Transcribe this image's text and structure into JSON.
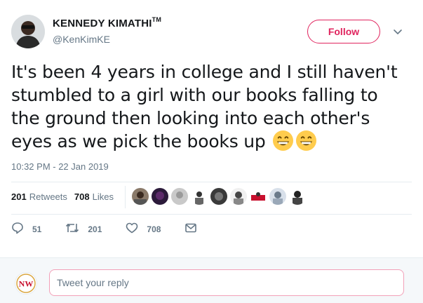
{
  "user": {
    "name": "KENNEDY KIMATHI",
    "trademark": "TM",
    "handle": "@KenKimKE"
  },
  "follow_label": "Follow",
  "tweet": {
    "text": "It's been 4 years in college and I still haven't stumbled to a girl with our books falling to the ground then looking into each other's eyes as we pick the books up",
    "emoji_names": [
      "grinning-face-icon",
      "grinning-face-icon"
    ],
    "timestamp": "10:32 PM - 22 Jan 2019"
  },
  "stats": {
    "retweets_count": "201",
    "retweets_label": "Retweets",
    "likes_count": "708",
    "likes_label": "Likes",
    "liker_avatar_count": 10
  },
  "actions": {
    "reply_count": "51",
    "retweet_count": "201",
    "like_count": "708"
  },
  "reply": {
    "placeholder": "Tweet your reply",
    "avatar_text": "NW"
  },
  "colors": {
    "accent": "#e0245e",
    "muted": "#657786",
    "text": "#14171a",
    "border": "#e6ecf0",
    "emoji_yellow": "#ffcc4d"
  }
}
